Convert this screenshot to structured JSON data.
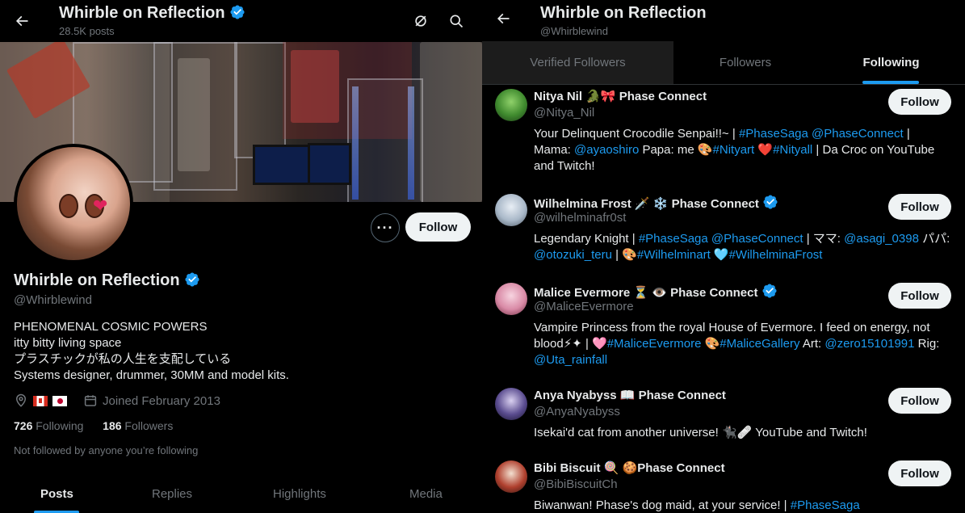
{
  "left": {
    "title": "Whirble on Reflection",
    "post_count": "28.5K posts",
    "profile": {
      "name": "Whirble on Reflection",
      "handle": "@Whirblewind",
      "bio": [
        "PHENOMENAL COSMIC POWERS",
        "itty bitty living space",
        "プラスチックが私の人生を支配している",
        "Systems designer, drummer, 30MM and model kits."
      ],
      "joined": "Joined February 2013",
      "following_count": "726",
      "following_label": "Following",
      "followers_count": "186",
      "followers_label": "Followers",
      "not_followed": "Not followed by anyone you’re following",
      "follow_label": "Follow",
      "more_label": "···"
    },
    "tabs": [
      "Posts",
      "Replies",
      "Highlights",
      "Media"
    ]
  },
  "right": {
    "title": "Whirble on Reflection",
    "handle": "@Whirblewind",
    "tabs": [
      "Verified Followers",
      "Followers",
      "Following"
    ],
    "users": [
      {
        "name": "Nitya Nil 🐊🎀 Phase Connect",
        "handle": "@Nitya_Nil",
        "verified": false,
        "bio_html": "Your Delinquent Crocodile Senpai!!~ | <span class='link'>#PhaseSaga</span> <span class='link'>@PhaseConnect</span> |<br>Mama: <span class='link'>@ayaoshiro</span> Papa: me 🎨<span class='link'>#Nityart</span> ❤️<span class='link'>#Nityall</span> | Da Croc on YouTube<br>and Twitch!",
        "follow": "Follow"
      },
      {
        "name": "Wilhelmina Frost 🗡️ ❄️ Phase Connect",
        "handle": "@wilhelminafr0st",
        "verified": true,
        "bio_html": "Legendary Knight | <span class='link'>#PhaseSaga</span> <span class='link'>@PhaseConnect</span> | ママ: <span class='link'>@asagi_0398</span> パパ:<br><span class='link'>@otozuki_teru</span> | 🎨<span class='link'>#Wilhelminart</span> 🩵<span class='link'>#WilhelminaFrost</span>",
        "follow": "Follow"
      },
      {
        "name": "Malice Evermore ⏳ 👁️ Phase Connect",
        "handle": "@MaliceEvermore",
        "verified": true,
        "bio_html": "Vampire Princess from the royal House of Evermore. I feed on energy, not<br>blood⚡✦ | 🩷<span class='link'>#MaliceEvermore</span> 🎨<span class='link'>#MaliceGallery</span> Art: <span class='link'>@zero15101991</span> Rig:<br><span class='link'>@Uta_rainfall</span>",
        "follow": "Follow"
      },
      {
        "name": "Anya Nyabyss 📖 Phase Connect",
        "handle": "@AnyaNyabyss",
        "verified": false,
        "bio_html": "Isekai'd cat from another universe! 🐈‍⬛🩹 YouTube and Twitch!",
        "follow": "Follow"
      },
      {
        "name": "Bibi Biscuit 🍭 🍪Phase Connect",
        "handle": "@BibiBiscuitCh",
        "verified": false,
        "bio_html": "Biwanwan! Phase's dog maid, at your service! | <span class='link'>#PhaseSaga</span>",
        "follow": "Follow"
      }
    ]
  },
  "colors": {
    "accent": "#1d9bf0",
    "background": "#000000",
    "text": "#e7e9ea",
    "muted": "#71767b"
  },
  "icons": {
    "back": "arrow-left-icon",
    "grok": "grok-icon",
    "search": "search-icon",
    "location": "location-pin-icon",
    "calendar": "calendar-icon",
    "verified": "verified-badge-icon"
  }
}
